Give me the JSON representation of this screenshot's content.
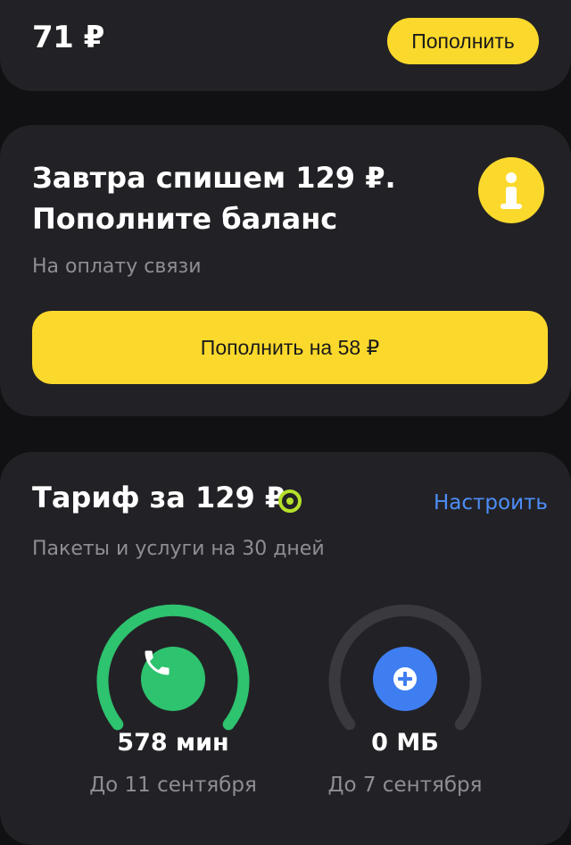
{
  "balance": {
    "amount": "71 ₽",
    "topup_label": "Пополнить"
  },
  "warning": {
    "title": "Завтра спишем 129 ₽. Пополните баланс",
    "subtitle": "На оплату связи",
    "topup_label": "Пополнить на 58 ₽",
    "icon": "info-icon"
  },
  "tariff": {
    "title": "Тариф за 129 ₽",
    "configure_label": "Настроить",
    "subtitle": "Пакеты и услуги на 30 дней",
    "packages": [
      {
        "value": "578 мин",
        "until": "До 11 сентября",
        "icon": "phone-icon",
        "remaining_fraction": 1.0,
        "color": "#2ec36e"
      },
      {
        "value": "0 МБ",
        "until": "До 7 сентября",
        "icon": "plus-icon",
        "remaining_fraction": 0.0,
        "color": "#3f7ef1"
      }
    ]
  },
  "colors": {
    "accent": "#fbd92c",
    "link": "#4d8ef6",
    "card": "#222226",
    "background": "#111113"
  }
}
